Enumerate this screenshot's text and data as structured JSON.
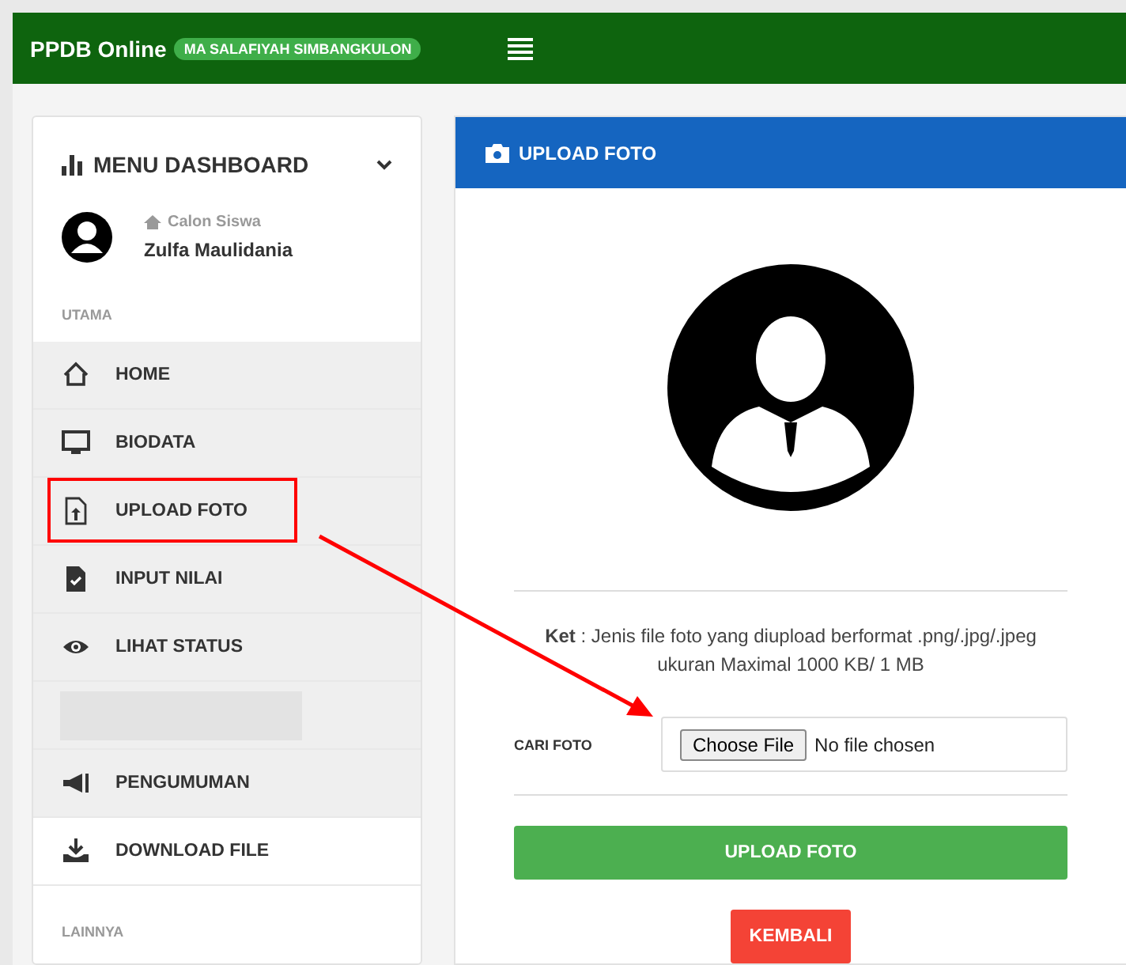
{
  "topbar": {
    "title": "PPDB Online",
    "school_badge": "MA SALAFIYAH SIMBANGKULON"
  },
  "sidebar": {
    "heading": "MENU DASHBOARD",
    "user_role": "Calon Siswa",
    "user_name": "Zulfa Maulidania",
    "section_label": "UTAMA",
    "items": [
      {
        "kind": "link",
        "label": "HOME",
        "shaded": true,
        "highlighted": false
      },
      {
        "kind": "link",
        "label": "BIODATA",
        "shaded": true,
        "highlighted": false
      },
      {
        "kind": "link",
        "label": "UPLOAD FOTO",
        "shaded": true,
        "highlighted": true
      },
      {
        "kind": "link",
        "label": "INPUT NILAI",
        "shaded": true,
        "highlighted": false
      },
      {
        "kind": "link",
        "label": "LIHAT STATUS",
        "shaded": true,
        "highlighted": false
      },
      {
        "kind": "blank",
        "shaded": true,
        "highlighted": false
      },
      {
        "kind": "link",
        "label": "PENGUMUMAN",
        "shaded": true,
        "highlighted": false
      },
      {
        "kind": "link",
        "label": "DOWNLOAD FILE",
        "shaded": false,
        "highlighted": false
      }
    ],
    "footer_label": "LAINNYA"
  },
  "panel": {
    "title": "UPLOAD FOTO",
    "note_label": "Ket",
    "note_text": " : Jenis file foto yang diupload berformat .png/.jpg/.jpeg ukuran Maximal 1000 KB/ 1 MB",
    "field_label": "CARI FOTO",
    "file_button": "Choose File",
    "file_status": "No file chosen",
    "submit": "UPLOAD FOTO",
    "back": "KEMBALI"
  }
}
